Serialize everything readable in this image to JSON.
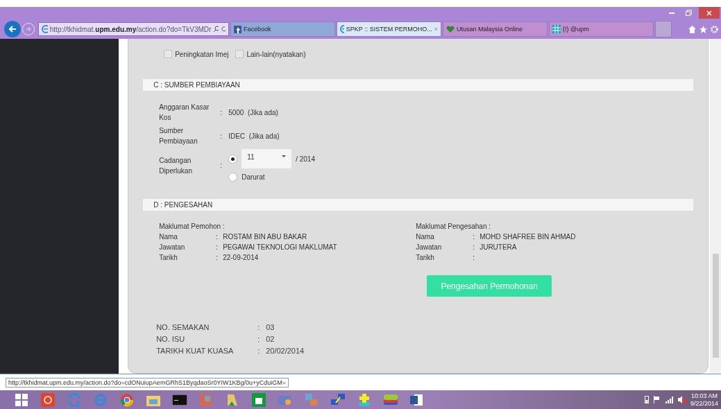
{
  "browser": {
    "address": "http://tkhidmat.**upm.edu.my**/action.do?do=TkV3MDr",
    "tabs": [
      {
        "label": "Facebook",
        "selected": false
      },
      {
        "label": "SPKP :: SISTEM PERMOHO...",
        "selected": true,
        "close": "×"
      },
      {
        "label": "Utusan Malaysia Online",
        "selected": false
      },
      {
        "label": "(!) @upm",
        "selected": false
      }
    ]
  },
  "options": [
    {
      "label": "Peningkatan Imej",
      "checked": false
    },
    {
      "label": "Lain-lain(nyatakan)",
      "checked": false
    }
  ],
  "section_c": {
    "title": "C : SUMBER PEMBIAYAAN",
    "fields": [
      {
        "label": "Anggaran Kasar Kos",
        "colon": ":",
        "value": "5000",
        "note": "(Jika ada)"
      },
      {
        "label": "Sumber Pembiayaan",
        "colon": ":",
        "value": "IDEC",
        "note": "(Jika ada)"
      }
    ],
    "cadangan": {
      "label": "Cadangan Diperlukan",
      "colon": ":",
      "choices": [
        {
          "kind": "month",
          "selected": true,
          "value": "11",
          "suffix": "/ 2014"
        },
        {
          "kind": "text",
          "selected": false,
          "label": "Darurat"
        }
      ]
    }
  },
  "section_d": {
    "title": "D : PENGESAHAN",
    "columns": [
      {
        "heading": "Maklumat Pemohon :",
        "rows": [
          {
            "label": "Nama",
            "colon": ":",
            "value": "ROSTAM BIN ABU BAKAR"
          },
          {
            "label": "Jawatan",
            "colon": ":",
            "value": "PEGAWAI TEKNOLOGI MAKLUMAT"
          },
          {
            "label": "Tarikh",
            "colon": ":",
            "value": "22-09-2014"
          }
        ]
      },
      {
        "heading": "Maklumat Pengesahan :",
        "rows": [
          {
            "label": "Nama",
            "colon": ":",
            "value": "MOHD SHAFREE BIN AHMAD"
          },
          {
            "label": "Jawatan",
            "colon": ":",
            "value": "JURUTERA"
          },
          {
            "label": "Tarikh",
            "colon": ":"
          }
        ]
      }
    ],
    "button": "Pengesahan Permohonan"
  },
  "document_info": [
    {
      "label": "NO. SEMAKAN",
      "colon": ":",
      "value": "03"
    },
    {
      "label": "NO. ISU",
      "colon": ":",
      "value": "02"
    },
    {
      "label": "TARIKH KUAT KUASA",
      "colon": ":",
      "value": "20/02/2014"
    }
  ],
  "status_url": "http://tkhidmat.upm.edu.my/action.do?do=cdONuiupAemGRhS1ByqdaoSr0YIW1KBg/0u+yCduiGM=",
  "clock": {
    "time": "10:03 AM",
    "date": "9/22/2014"
  }
}
